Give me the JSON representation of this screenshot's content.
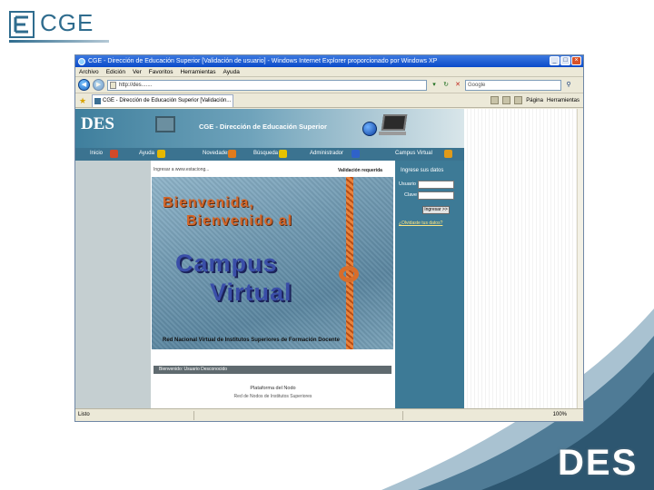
{
  "slide": {
    "logo_text": "CGE",
    "logo_subtitle": "",
    "corner_logo": "DES"
  },
  "browser": {
    "title": "CGE - Dirección de Educación Superior [Validación de usuario] - Windows Internet Explorer proporcionado por Windows XP",
    "menu": [
      "Archivo",
      "Edición",
      "Ver",
      "Favoritos",
      "Herramientas",
      "Ayuda"
    ],
    "address": "http://des.......",
    "search_placeholder": "Google",
    "tab_label": "CGE - Dirección de Educación Superior [Validación...",
    "tools": [
      "Página",
      "Herramientas"
    ],
    "status_left": "Listo",
    "status_zoom": "100%"
  },
  "page": {
    "header_title": "CGE - Dirección de Educación Superior",
    "des_mark": "DES",
    "nav": [
      "Inicio",
      "Ayuda",
      "Novedades",
      "Búsqueda",
      "Administrador",
      "Campus Virtual"
    ],
    "top_left_text": "Ingresar a www.estaciong...",
    "top_right_text": "Validación requerida",
    "banner": {
      "line1": "Bienvenida,",
      "line2": "Bienvenido al",
      "campus1": "Campus",
      "campus2": "Virtual",
      "caption": "Red Nacional Virtual de Institutos Superiores de Formación Docente"
    },
    "welcome_bar": "Bienvenido: Usuario Desconocido",
    "footer_line1": "Plataforma del Nodo",
    "footer_line2": "Red de Nodos de Institutos Superiores",
    "login": {
      "title": "Ingrese sus datos",
      "user_label": "Usuario",
      "pass_label": "Clave",
      "button": "Ingresar >>",
      "forgot_link": "¿Olvidaste tus datos?"
    }
  },
  "colors": {
    "header_teal": "#3f7f9d",
    "panel_teal": "#3d7a96",
    "banner_orange": "#d2662a",
    "banner_blue": "#3a4ea8"
  }
}
